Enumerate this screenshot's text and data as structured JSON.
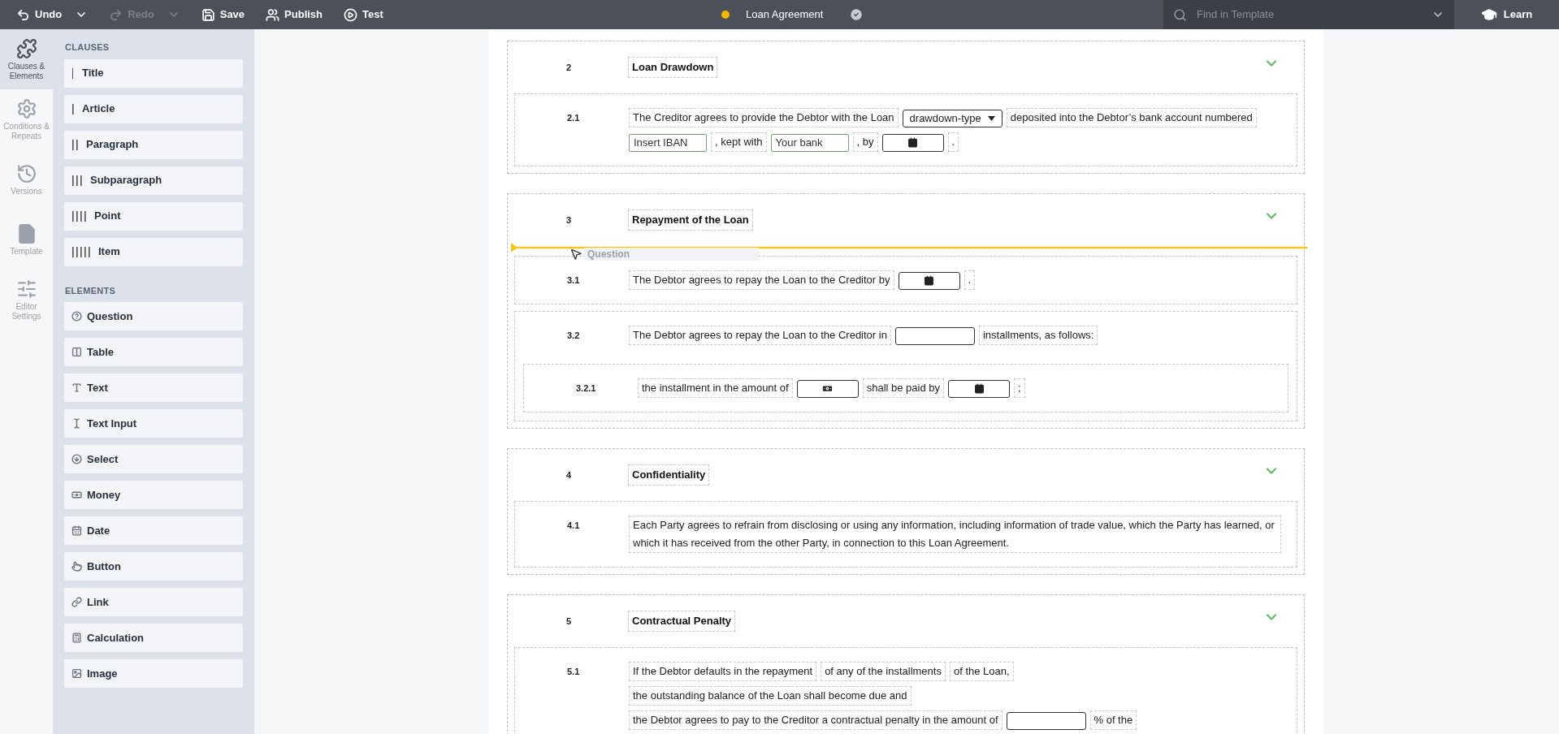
{
  "toolbar": {
    "buttons": [
      {
        "kind": "undo",
        "label": "Undo",
        "disabled": false
      },
      {
        "kind": "redo",
        "label": "Redo",
        "disabled": true
      },
      {
        "kind": "save",
        "label": "Save",
        "disabled": false
      },
      {
        "kind": "publish",
        "label": "Publish",
        "disabled": false
      },
      {
        "kind": "test",
        "label": "Test",
        "disabled": false
      }
    ],
    "document_title": "Loan Agreement",
    "search": {
      "placeholder": "Find in Template"
    },
    "learn": "Learn"
  },
  "rail": [
    {
      "kind": "clauses",
      "label": "Clauses & Elements",
      "selected": true
    },
    {
      "kind": "conditions",
      "label": "Conditions & Repeats",
      "selected": false
    },
    {
      "kind": "versions",
      "label": "Versions",
      "selected": false
    },
    {
      "kind": "template",
      "label": "Template",
      "selected": false
    },
    {
      "kind": "settings",
      "label": "Editor Settings",
      "selected": false
    }
  ],
  "panel": {
    "clauses_heading": "CLAUSES",
    "clauses": [
      {
        "kind": "title",
        "label": "Title"
      },
      {
        "kind": "article",
        "label": "Article"
      },
      {
        "kind": "paragraph",
        "label": "Paragraph"
      },
      {
        "kind": "subparagraph",
        "label": "Subparagraph"
      },
      {
        "kind": "point",
        "label": "Point"
      },
      {
        "kind": "item",
        "label": "Item"
      }
    ],
    "elements_heading": "ELEMENTS",
    "elements": [
      {
        "kind": "question",
        "label": "Question"
      },
      {
        "kind": "table",
        "label": "Table"
      },
      {
        "kind": "text",
        "label": "Text"
      },
      {
        "kind": "text_input",
        "label": "Text Input"
      },
      {
        "kind": "select",
        "label": "Select"
      },
      {
        "kind": "money",
        "label": "Money"
      },
      {
        "kind": "date",
        "label": "Date"
      },
      {
        "kind": "button",
        "label": "Button"
      },
      {
        "kind": "link",
        "label": "Link"
      },
      {
        "kind": "calculation",
        "label": "Calculation"
      },
      {
        "kind": "image",
        "label": "Image"
      }
    ]
  },
  "document": {
    "sections": [
      {
        "number": "2",
        "title": "Loan Drawdown",
        "paragraphs": [
          {
            "number": "2.1",
            "segments": [
              {
                "kind": "text",
                "text": "The Creditor agrees to provide the Debtor with the Loan"
              },
              {
                "kind": "select",
                "value": "drawdown-type"
              },
              {
                "kind": "text",
                "text": "deposited into the Debtor’s bank account numbered"
              },
              {
                "kind": "input",
                "placeholder": "Insert IBAN"
              },
              {
                "kind": "text",
                "text": ", kept with"
              },
              {
                "kind": "input",
                "placeholder": "Your bank"
              },
              {
                "kind": "text",
                "text": ", by"
              },
              {
                "kind": "date"
              },
              {
                "kind": "text",
                "text": "."
              }
            ]
          }
        ]
      },
      {
        "number": "3",
        "title": "Repayment of the Loan",
        "drag_preview": {
          "label": "Question"
        },
        "paragraphs": [
          {
            "number": "3.1",
            "segments": [
              {
                "kind": "text",
                "text": "The Debtor agrees to repay the Loan to the Creditor by"
              },
              {
                "kind": "date"
              },
              {
                "kind": "text",
                "text": "."
              }
            ]
          },
          {
            "number": "3.2",
            "segments": [
              {
                "kind": "text",
                "text": "The Debtor agrees to repay the Loan to the Creditor in"
              },
              {
                "kind": "blank"
              },
              {
                "kind": "text",
                "text": "installments, as follows:"
              }
            ],
            "children": [
              {
                "number": "3.2.1",
                "segments": [
                  {
                    "kind": "text",
                    "text": "the installment in the amount of"
                  },
                  {
                    "kind": "money"
                  },
                  {
                    "kind": "text",
                    "text": "shall be paid by"
                  },
                  {
                    "kind": "date"
                  },
                  {
                    "kind": "text",
                    "text": ";"
                  }
                ]
              }
            ]
          }
        ]
      },
      {
        "number": "4",
        "title": "Confidentiality",
        "paragraphs": [
          {
            "number": "4.1",
            "segments": [
              {
                "kind": "text",
                "text": "Each Party agrees to refrain from disclosing or using any information, including information of trade value, which the Party has learned, or which it has received from the other Party, in connection to this Loan Agreement."
              }
            ]
          }
        ]
      },
      {
        "number": "5",
        "title": "Contractual Penalty",
        "paragraphs": [
          {
            "number": "5.1",
            "segments": [
              {
                "kind": "text",
                "text": "If the Debtor defaults in the repayment"
              },
              {
                "kind": "text",
                "text": "of any of the installments"
              },
              {
                "kind": "text",
                "text": "of the Loan,"
              },
              {
                "kind": "text",
                "text": "the outstanding balance of the Loan shall become due and"
              },
              {
                "kind": "text",
                "text": "the Debtor agrees to pay to the Creditor a contractual penalty in the amount of"
              },
              {
                "kind": "blank"
              },
              {
                "kind": "text",
                "text": "% of the"
              }
            ]
          }
        ]
      }
    ]
  }
}
